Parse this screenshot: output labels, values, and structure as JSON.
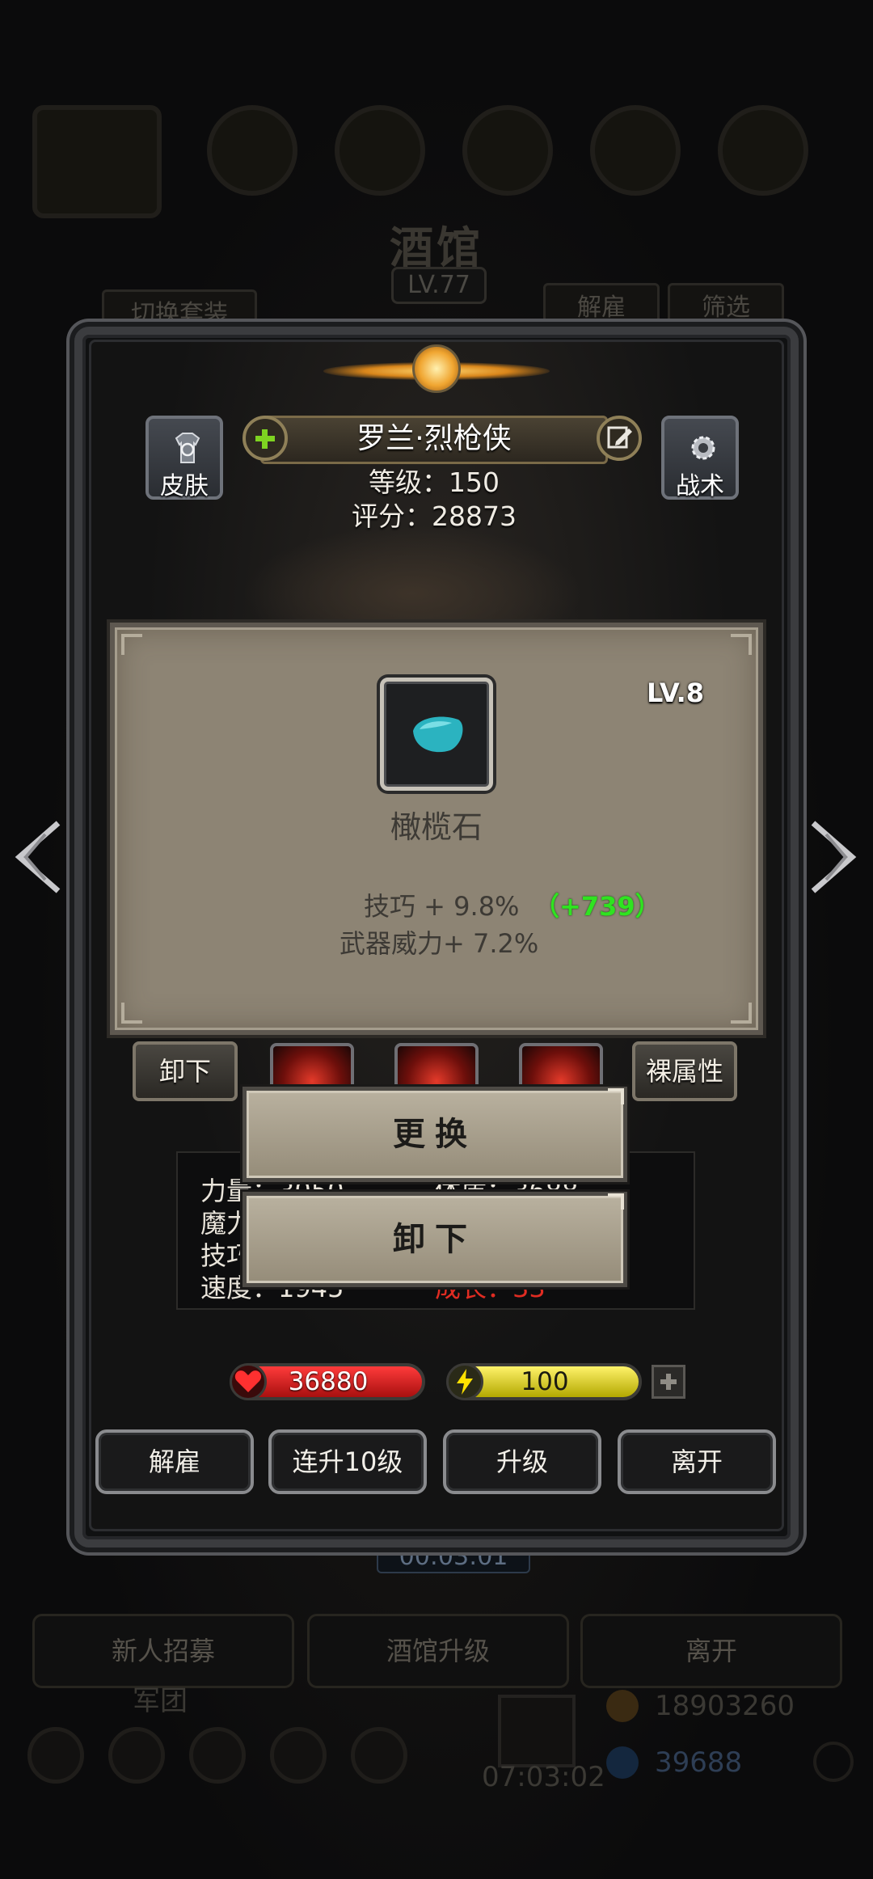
{
  "background": {
    "tavern_title": "酒馆",
    "tavern_level": "LV.77",
    "switch_set_label": "切换套装",
    "dismiss_label": "解雇",
    "filter_label": "筛选",
    "timer": "00:03:01",
    "bottom_buttons": [
      "新人招募",
      "酒馆升级",
      "离开"
    ],
    "team_label": "军团",
    "gold": "18903260",
    "gems": "39688",
    "chest_timer": "07:03:02"
  },
  "hero": {
    "skin_label": "皮肤",
    "tactics_label": "战术",
    "name": "罗兰·烈枪侠",
    "level_text": "等级：150",
    "score_text": "评分：28873"
  },
  "item": {
    "level": "LV.8",
    "name": "橄榄石",
    "attr1": "技巧 + 9.8%",
    "attr1_bonus": "（+739）",
    "attr2": "武器威力+ 7.2%",
    "gem_color": "#2bb3c0"
  },
  "equip_row": {
    "unequip_label": "卸下",
    "naked_stats_label": "裸属性"
  },
  "stats": {
    "row1_left": "力量：3050",
    "row1_right": "体质：3688",
    "row2_left": "魔力",
    "row3_left": "技巧",
    "row4_left": "速度：1945",
    "row4_right": "成长：33"
  },
  "popup": {
    "replace_label": "更换",
    "unequip_label": "卸下"
  },
  "bars": {
    "hp": "36880",
    "energy": "100"
  },
  "actions": {
    "dismiss": "解雇",
    "level_up_10": "连升10级",
    "level_up": "升级",
    "leave": "离开"
  }
}
